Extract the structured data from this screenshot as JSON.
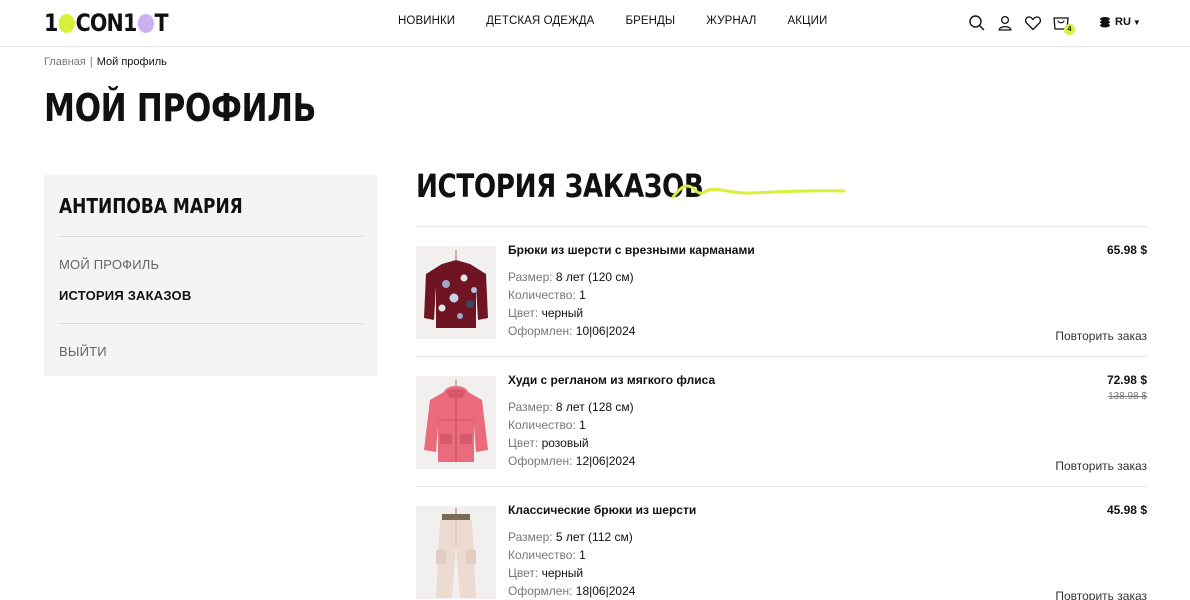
{
  "brand": {
    "logo_text_a": "1",
    "logo_text_b": "CON1",
    "logo_text_c": "T",
    "accent_yellow": "#d8f03a",
    "accent_lilac": "#c8b2f2"
  },
  "header": {
    "nav": [
      "НОВИНКИ",
      "ДЕТСКАЯ ОДЕЖДА",
      "БРЕНДЫ",
      "ЖУРНАЛ",
      "АКЦИИ"
    ],
    "icons": [
      "search-icon",
      "user-icon",
      "heart-icon",
      "cart-icon"
    ],
    "cart_count": "4",
    "lang": "RU"
  },
  "breadcrumb": {
    "home": "Главная",
    "current": "Мой профиль"
  },
  "page_title": "МОЙ ПРОФИЛЬ",
  "sidebar": {
    "user_name": "АНТИПОВА МАРИЯ",
    "links": {
      "profile": "МОЙ ПРОФИЛЬ",
      "orders": "ИСТОРИЯ ЗАКАЗОВ",
      "logout": "ВЫЙТИ"
    },
    "active": "orders"
  },
  "orders_section": {
    "title": "ИСТОРИЯ ЗАКАЗОВ",
    "labels": {
      "size": "Размер:",
      "quantity": "Количество:",
      "color": "Цвет:",
      "placed": "Оформлен:",
      "repeat": "Повторить заказ"
    },
    "orders": [
      {
        "name": "Брюки из шерсти с врезными карманами",
        "size": "8 лет (120 см)",
        "quantity": "1",
        "color": "черный",
        "placed": "10|06|2024",
        "price": "65.98 $",
        "old_price": "",
        "image": "burgundy-flower-sweater"
      },
      {
        "name": "Худи с регланом из мягкого флиса",
        "size": "8 лет (128 см)",
        "quantity": "1",
        "color": "розовый",
        "placed": "12|06|2024",
        "price": "72.98 $",
        "old_price": "138.98 $",
        "image": "pink-puffer-jacket"
      },
      {
        "name": "Классические брюки из шерсти",
        "size": "5 лет (112 см)",
        "quantity": "1",
        "color": "черный",
        "placed": "18|06|2024",
        "price": "45.98 $",
        "old_price": "",
        "image": "beige-cargo-pants"
      }
    ]
  }
}
